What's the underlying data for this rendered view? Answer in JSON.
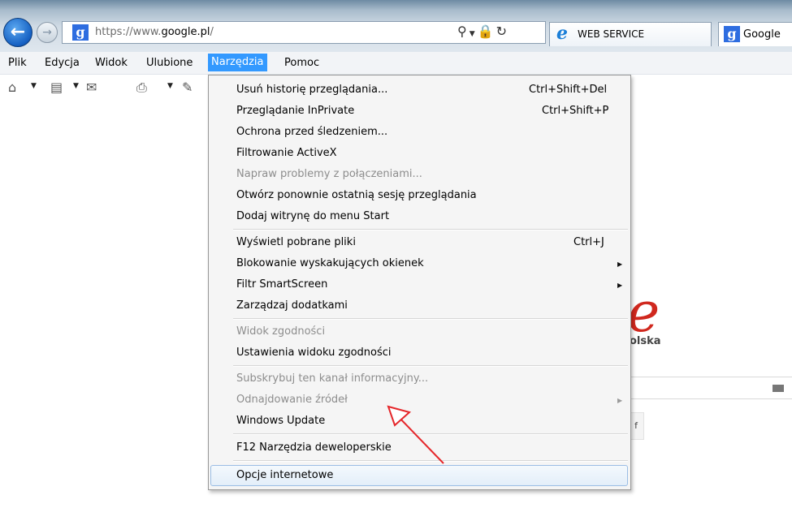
{
  "address_bar": {
    "url_prefix": "https://www.",
    "url_domain": "google.pl",
    "url_suffix": "/"
  },
  "tabs": [
    {
      "label": "WEB SERVICE"
    },
    {
      "label": "Google"
    }
  ],
  "menubar": {
    "items": [
      "Plik",
      "Edycja",
      "Widok",
      "Ulubione",
      "Narzędzia",
      "Pomoc"
    ],
    "active": "Narzędzia"
  },
  "dropdown": {
    "groups": [
      [
        {
          "label": "Usuń historię przeglądania...",
          "shortcut": "Ctrl+Shift+Del",
          "enabled": true
        },
        {
          "label": "Przeglądanie InPrivate",
          "shortcut": "Ctrl+Shift+P",
          "enabled": true
        },
        {
          "label": "Ochrona przed śledzeniem...",
          "enabled": true
        },
        {
          "label": "Filtrowanie ActiveX",
          "enabled": true
        },
        {
          "label": "Napraw problemy z połączeniami...",
          "enabled": false
        },
        {
          "label": "Otwórz ponownie ostatnią sesję przeglądania",
          "enabled": true
        },
        {
          "label": "Dodaj witrynę do menu Start",
          "enabled": true
        }
      ],
      [
        {
          "label": "Wyświetl pobrane pliki",
          "shortcut": "Ctrl+J",
          "enabled": true
        },
        {
          "label": "Blokowanie wyskakujących okienek",
          "submenu": true,
          "enabled": true
        },
        {
          "label": "Filtr SmartScreen",
          "submenu": true,
          "enabled": true
        },
        {
          "label": "Zarządzaj dodatkami",
          "enabled": true
        }
      ],
      [
        {
          "label": "Widok zgodności",
          "enabled": false
        },
        {
          "label": "Ustawienia widoku zgodności",
          "enabled": true
        }
      ],
      [
        {
          "label": "Subskrybuj ten kanał informacyjny...",
          "enabled": false
        },
        {
          "label": "Odnajdowanie źródeł",
          "submenu": true,
          "enabled": false
        },
        {
          "label": "Windows Update",
          "enabled": true
        }
      ],
      [
        {
          "label": "F12 Narzędzia deweloperskie",
          "enabled": true
        }
      ],
      [
        {
          "label": "Opcje internetowe",
          "enabled": true,
          "highlighted": true
        }
      ]
    ]
  },
  "page": {
    "logo_text": "olska",
    "button_stub": "f"
  },
  "colors": {
    "menu_active": "#3399ff",
    "annotation": "#e5262a",
    "ie_logo": "#d0281e"
  }
}
